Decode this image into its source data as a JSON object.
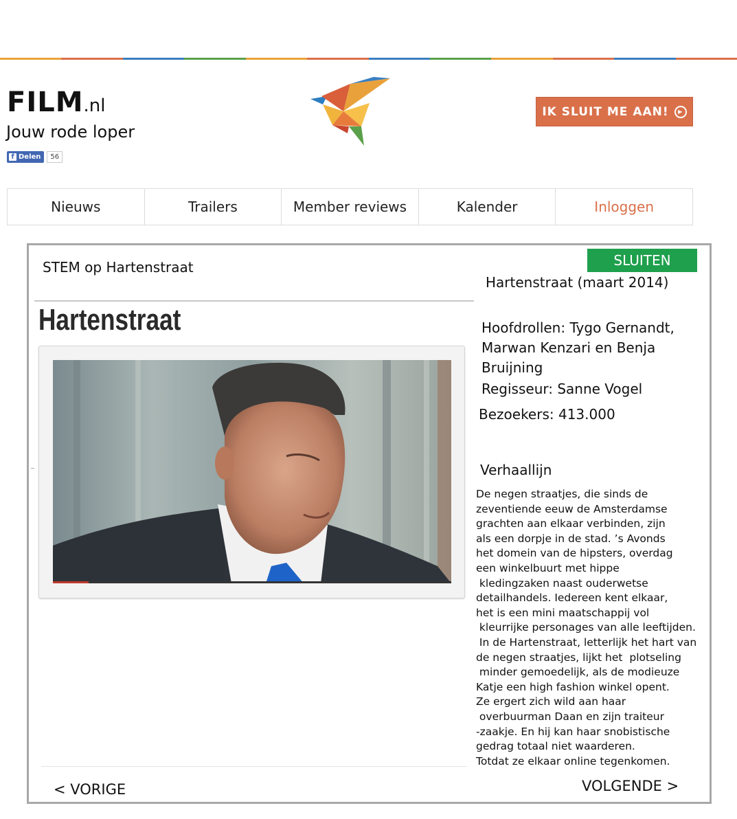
{
  "header": {
    "brand_main": "FILM",
    "brand_tld": ".nl",
    "tagline": "Jouw rode loper",
    "share_label": "Delen",
    "share_count": "56",
    "join_label": "IK SLUIT ME AAN!",
    "rainbow_colors": [
      "#e9a23b",
      "#d9704a",
      "#3a7fc1",
      "#5aa04a",
      "#e9a23b",
      "#d9704a",
      "#3a7fc1",
      "#5aa04a",
      "#e9a23b",
      "#d9704a",
      "#3a7fc1",
      "#d9704a"
    ]
  },
  "nav": {
    "items": [
      {
        "label": "Nieuws"
      },
      {
        "label": "Trailers"
      },
      {
        "label": "Member reviews"
      },
      {
        "label": "Kalender"
      },
      {
        "label": "Inloggen"
      }
    ]
  },
  "modal": {
    "vote_label": "STEM op Hartenstraat",
    "close_label": "SLUITEN",
    "title": "Hartenstraat",
    "video_progress": 0.09,
    "prev_label": "< VORIGE",
    "next_label": "VOLGENDE >",
    "details": {
      "film_name": "Hartenstraat (maart 2014)",
      "cast": "Hoofdrollen: Tygo Gernandt, Marwan Kenzari en Benja Bruijning",
      "director": "Regisseur: Sanne Vogel",
      "visitors": "Bezoekers: 413.000",
      "story_heading": "Verhaallijn",
      "story_lines": [
        "De negen straatjes, die sinds de",
        "zeventiende eeuw de Amsterdamse",
        "grachten aan elkaar verbinden, zijn",
        "als een dorpje in de stad. ’s Avonds",
        "het domein van de hipsters, overdag",
        "een winkelbuurt met hippe",
        " kledingzaken naast ouderwetse",
        "detailhandels. Iedereen kent elkaar,",
        "het is een mini maatschappij vol",
        " kleurrijke personages van alle leeftijden.",
        " In de Hartenstraat, letterlijk het hart van",
        "de negen straatjes, lijkt het  plotseling",
        " minder gemoedelijk, als de modieuze",
        "Katje een high fashion winkel opent.",
        "Ze ergert zich wild aan haar",
        " overbuurman Daan en zijn traiteur",
        "-zaakje. En hij kan haar snobistische",
        "gedrag totaal niet waarderen.",
        "Totdat ze elkaar online tegenkomen."
      ]
    }
  },
  "icons": {
    "logo": "origami-bird-logo",
    "join": "play-circle-icon",
    "share": "facebook-icon"
  }
}
